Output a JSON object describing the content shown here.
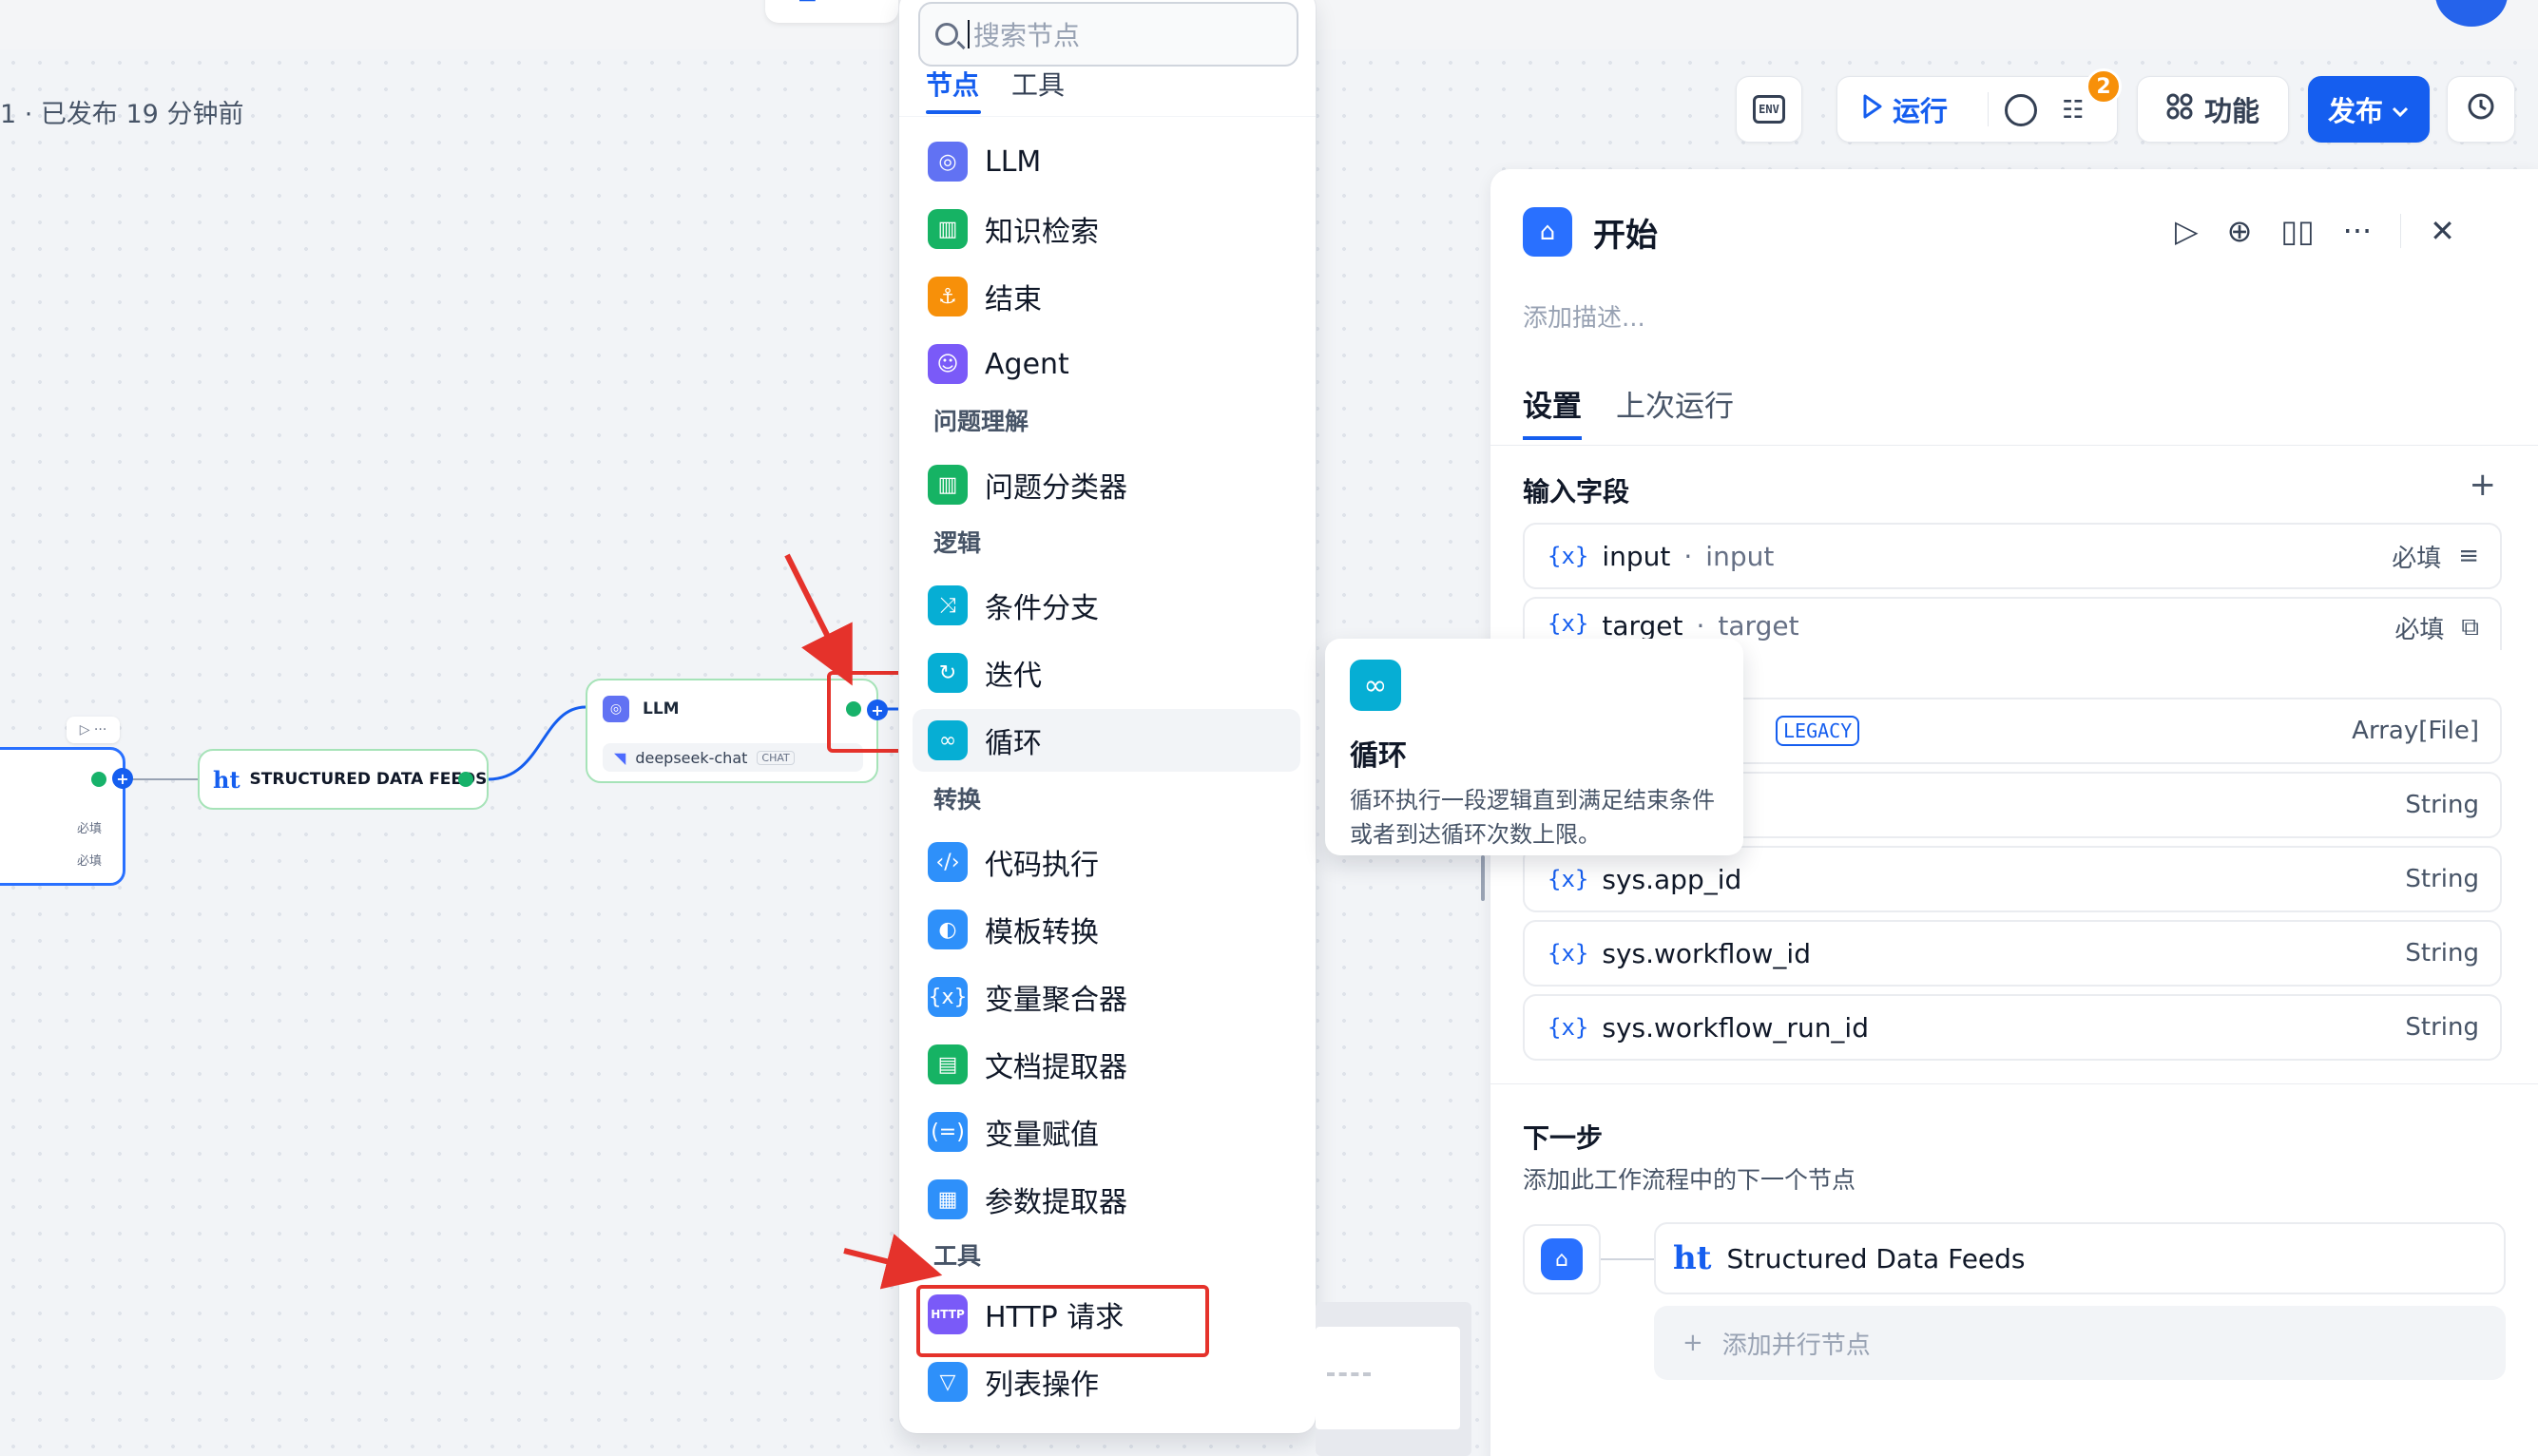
{
  "subtitle": "1 · 已发布 19 分钟前",
  "toolbar": {
    "env_label": "ENV",
    "run_label": "运行",
    "checklist_badge": "2",
    "features_label": "功能",
    "publish_label": "发布"
  },
  "canvas": {
    "left_node_rows": [
      "必填",
      "必填"
    ],
    "sdf_node_logo": "ht",
    "sdf_node_label": "STRUCTURED DATA FEEDS",
    "llm_node_title": "LLM",
    "llm_node_model": "deepseek-chat",
    "llm_node_model_tag": "CHAT"
  },
  "dropdown": {
    "search_placeholder": "搜索节点",
    "tabs": [
      "节点",
      "工具"
    ],
    "items_top": [
      "LLM",
      "知识检索",
      "结束",
      "Agent"
    ],
    "cat_understanding": "问题理解",
    "items_understanding": [
      "问题分类器"
    ],
    "cat_logic": "逻辑",
    "items_logic": [
      "条件分支",
      "迭代",
      "循环"
    ],
    "cat_transform": "转换",
    "items_transform": [
      "代码执行",
      "模板转换",
      "变量聚合器",
      "文档提取器",
      "变量赋值",
      "参数提取器"
    ],
    "cat_tools": "工具",
    "items_tools": [
      "HTTP 请求",
      "列表操作"
    ],
    "http_icon_text": "HTTP"
  },
  "tooltip": {
    "title": "循环",
    "desc": "循环执行一段逻辑直到满足结束条件或者到达循环次数上限。"
  },
  "panel": {
    "title": "开始",
    "desc_placeholder": "添加描述...",
    "tabs": [
      "设置",
      "上次运行"
    ],
    "section_title": "输入字段",
    "fields": [
      {
        "name": "input",
        "label": "input",
        "right": "必填"
      },
      {
        "name": "target",
        "label": "target",
        "right": "必填"
      },
      {
        "name": "",
        "label": "",
        "tag": "LEGACY",
        "right": "Array[File]"
      },
      {
        "name": "",
        "label": "",
        "right": "String"
      },
      {
        "name": "sys.app_id",
        "label": "",
        "right": "String"
      },
      {
        "name": "sys.workflow_id",
        "label": "",
        "right": "String"
      },
      {
        "name": "sys.workflow_run_id",
        "label": "",
        "right": "String"
      }
    ],
    "var_symbol": "{x}",
    "next_title": "下一步",
    "next_desc": "添加此工作流程中的下一个节点",
    "next_node_logo": "ht",
    "next_node_label": "Structured Data Feeds",
    "add_parallel": "添加并行节点"
  },
  "colors": {
    "accent": "#155eef",
    "annotation_red": "#e5322b",
    "success": "#17b26a"
  }
}
